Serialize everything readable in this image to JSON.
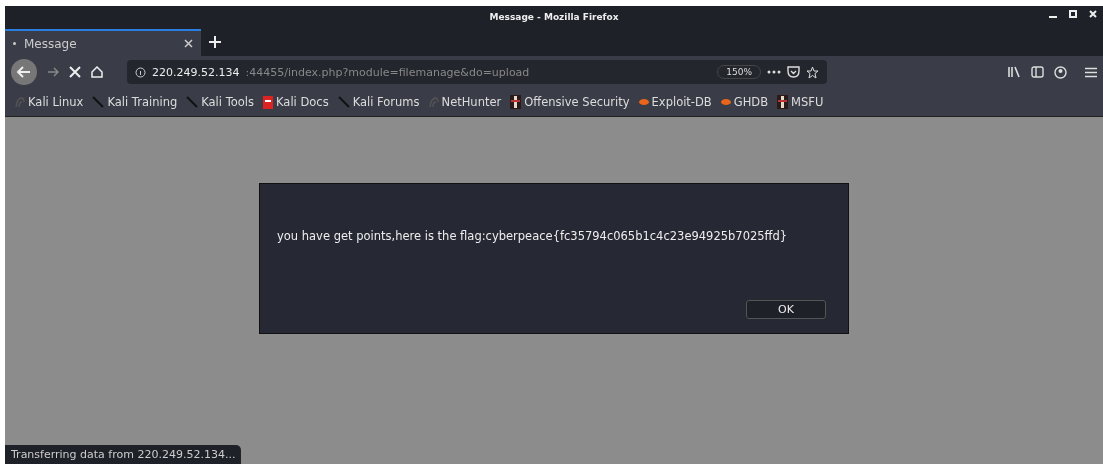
{
  "window": {
    "title": "Message - Mozilla Firefox"
  },
  "tabs": [
    {
      "label": "Message",
      "selected": true
    }
  ],
  "address_bar": {
    "host": "220.249.52.134",
    "path": ":44455/index.php?module=filemanage&do=upload",
    "zoom": "150%"
  },
  "bookmarks": [
    {
      "label": "Kali Linux",
      "kind": "dragon"
    },
    {
      "label": "Kali Training",
      "kind": "tool"
    },
    {
      "label": "Kali Tools",
      "kind": "tool"
    },
    {
      "label": "Kali Docs",
      "kind": "docs"
    },
    {
      "label": "Kali Forums",
      "kind": "tool"
    },
    {
      "label": "NetHunter",
      "kind": "dragon"
    },
    {
      "label": "Offensive Security",
      "kind": "offsec"
    },
    {
      "label": "Exploit-DB",
      "kind": "bug"
    },
    {
      "label": "GHDB",
      "kind": "bug"
    },
    {
      "label": "MSFU",
      "kind": "offsec"
    }
  ],
  "dialog": {
    "message": "you have get points,here is the flag:cyberpeace{fc35794c065b1c4c23e94925b7025ffd}",
    "button": "OK"
  },
  "status_bar": "Transferring data from 220.249.52.134..."
}
